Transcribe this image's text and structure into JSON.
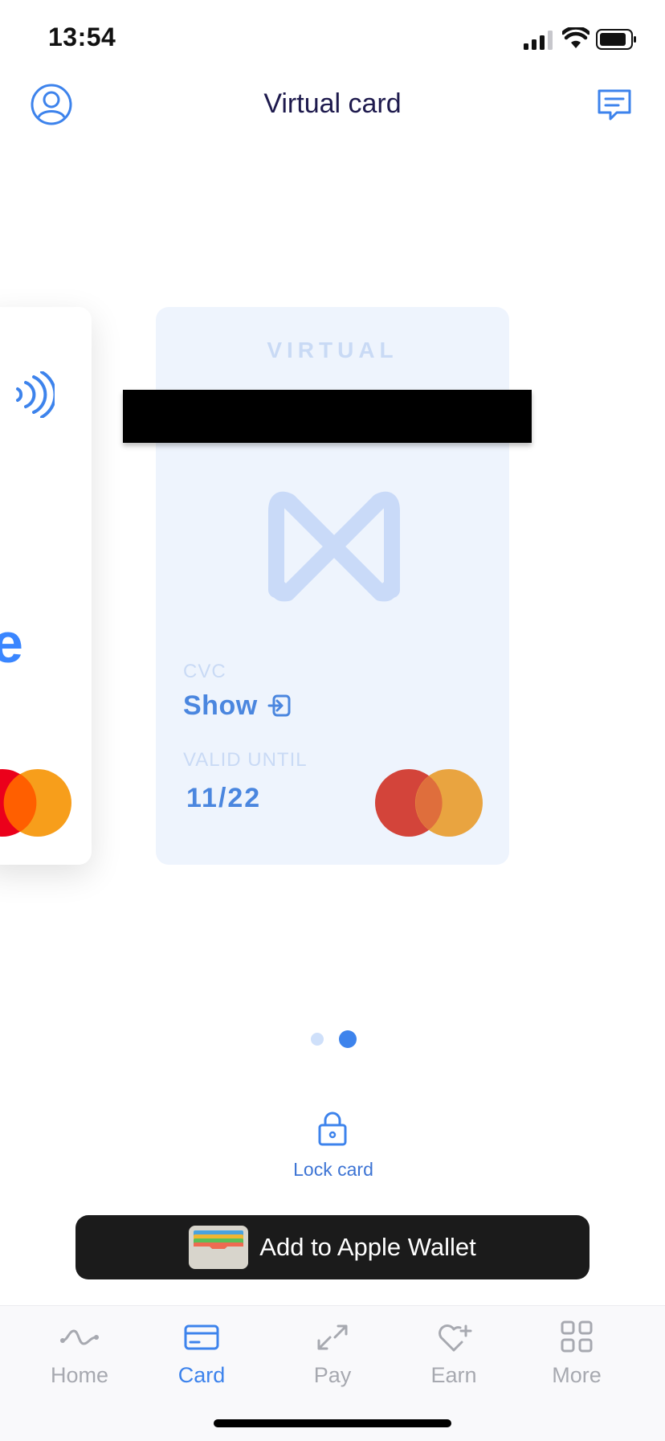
{
  "status_bar": {
    "time": "13:54"
  },
  "header": {
    "title": "Virtual card",
    "profile_icon": "profile-icon",
    "chat_icon": "chat-icon"
  },
  "card": {
    "label": "VIRTUAL",
    "cvc_label": "CVC",
    "cvc_action": "Show",
    "valid_until_label": "VALID UNTIL",
    "valid_until": "11/22"
  },
  "left_card": {
    "letter": "e"
  },
  "pager": {
    "count": 2,
    "active": 2
  },
  "lock": {
    "label": "Lock card"
  },
  "wallet": {
    "label": "Add to Apple Wallet"
  },
  "tabs": [
    {
      "label": "Home",
      "icon": "home-wave-icon"
    },
    {
      "label": "Card",
      "icon": "card-icon",
      "active": true
    },
    {
      "label": "Pay",
      "icon": "pay-arrows-icon"
    },
    {
      "label": "Earn",
      "icon": "earn-heart-icon"
    },
    {
      "label": "More",
      "icon": "more-grid-icon"
    }
  ],
  "colors": {
    "accent": "#3d83ec",
    "title": "#1e1a4d",
    "card_bg": "#eef4fd",
    "mastercard_red": "#eb001b",
    "mastercard_orange": "#f79e1b"
  }
}
